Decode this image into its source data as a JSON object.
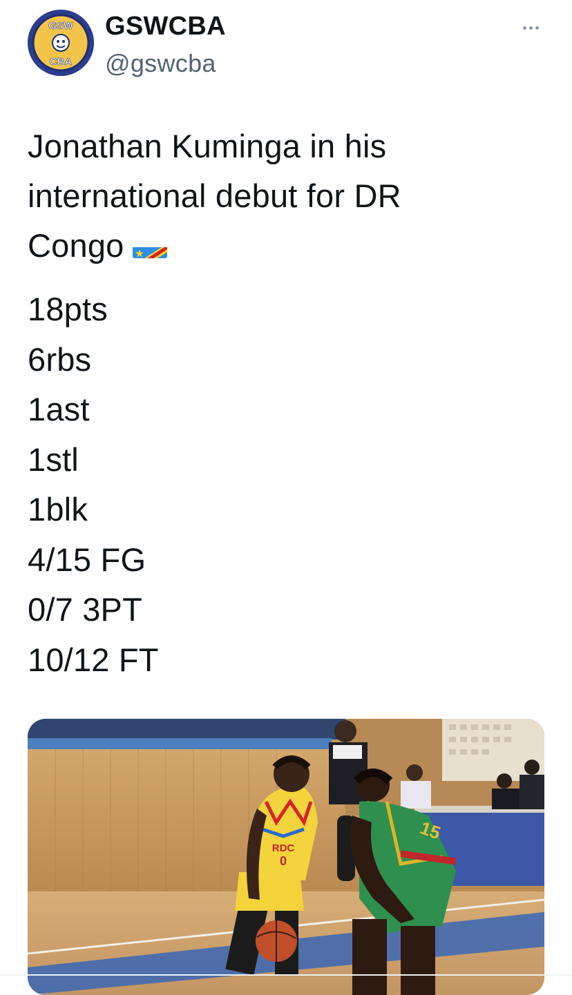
{
  "author": {
    "display_name": "GSWCBA",
    "handle": "@gswcba",
    "avatar_text_top": "GSW",
    "avatar_text_bottom": "CBA",
    "avatar_colors": {
      "ring": "#2b3d8c",
      "fill": "#f2c54a"
    }
  },
  "actions": {
    "more_icon": "more-horizontal-icon"
  },
  "tweet": {
    "intro_lines": [
      "Jonathan Kuminga in his",
      "international debut for DR",
      "Congo"
    ],
    "flag_icon": "flag-dr-congo-icon",
    "stats": [
      "18pts",
      "6rbs",
      "1ast",
      "1stl",
      "1blk",
      "4/15 FG",
      "0/7 3PT",
      "10/12 FT"
    ]
  },
  "media": {
    "type": "photo",
    "jersey_front_text": "RDC",
    "jersey_number": "0",
    "opponent_number": "15",
    "colors": {
      "floor": "#c9a068",
      "wall": "#c7975c",
      "court_blue": "#3a66b5"
    }
  }
}
